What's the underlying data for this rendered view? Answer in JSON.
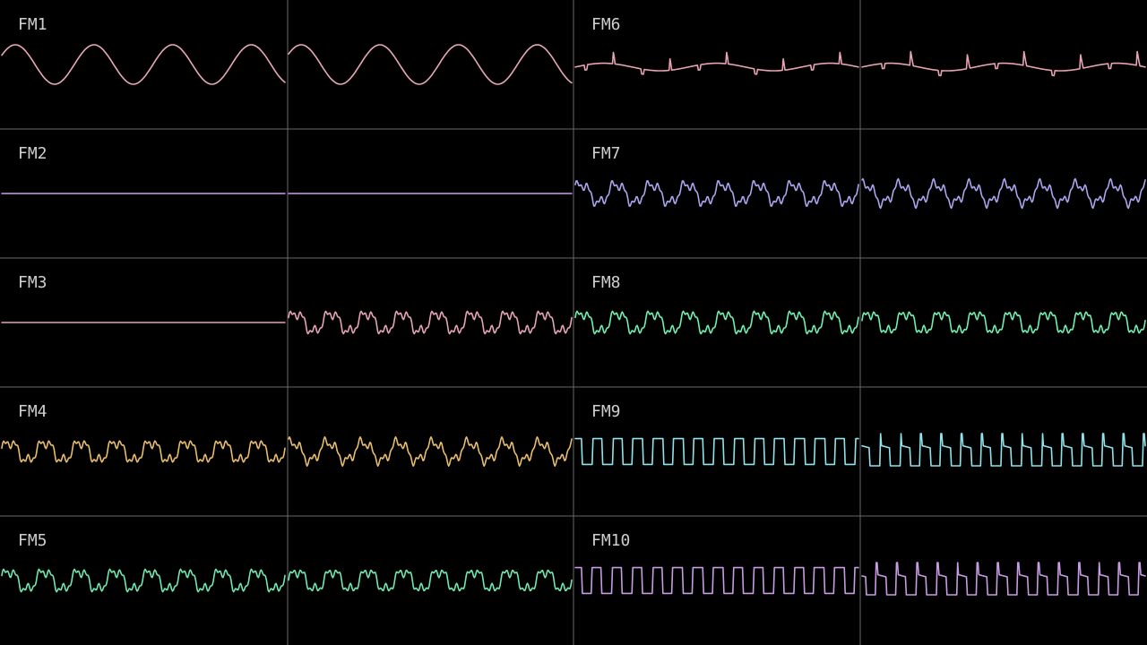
{
  "channels": [
    {
      "label": "FM1",
      "color": "#e8a6bf",
      "left": "sine",
      "right": "sine"
    },
    {
      "label": "FM2",
      "color": "#d29aef",
      "left": "flat",
      "right": "flat"
    },
    {
      "label": "FM3",
      "color": "#e6a2bb",
      "left": "flat",
      "right": "complex"
    },
    {
      "label": "FM4",
      "color": "#e8bd6c",
      "left": "complex",
      "right": "complex"
    },
    {
      "label": "FM5",
      "color": "#6fe9b0",
      "left": "complex",
      "right": "complex"
    },
    {
      "label": "FM6",
      "color": "#e9a3b2",
      "left": "spiky",
      "right": "spiky"
    },
    {
      "label": "FM7",
      "color": "#a9a5ee",
      "left": "complex",
      "right": "complex"
    },
    {
      "label": "FM8",
      "color": "#6ff0b2",
      "left": "complex",
      "right": "complex"
    },
    {
      "label": "FM9",
      "color": "#8ee4ec",
      "left": "square",
      "right": "pulse"
    },
    {
      "label": "FM10",
      "color": "#c89ce3",
      "left": "square",
      "right": "pulse"
    }
  ]
}
